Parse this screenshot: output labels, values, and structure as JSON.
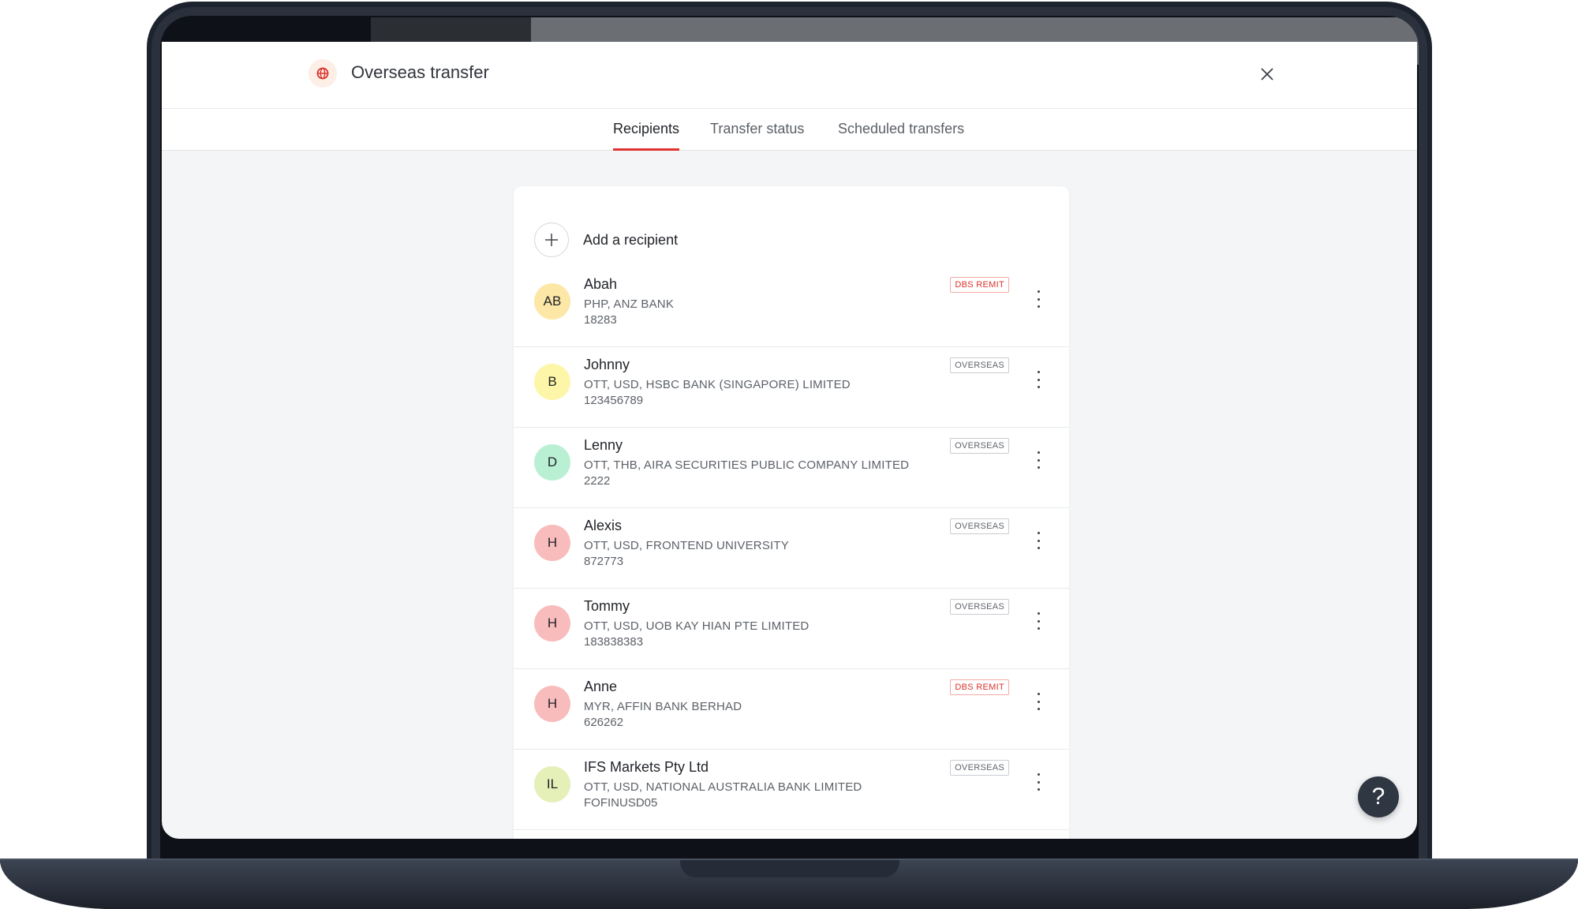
{
  "header": {
    "title": "Overseas transfer",
    "logo_icon": "globe-icon",
    "close_icon": "close-icon"
  },
  "tabs": [
    {
      "label": "Recipients",
      "active": true
    },
    {
      "label": "Transfer status",
      "active": false
    },
    {
      "label": "Scheduled transfers",
      "active": false
    }
  ],
  "add_recipient": {
    "label": "Add a recipient",
    "icon": "plus-icon"
  },
  "recipients": [
    {
      "initials": "AB",
      "name": "Abah",
      "detail": "PHP, ANZ BANK",
      "account": "18283",
      "badge": "DBS REMIT",
      "badge_type": "remit",
      "avatar_color": "#fde7a6"
    },
    {
      "initials": "B",
      "name": "Johnny",
      "detail": "OTT, USD, HSBC BANK (SINGAPORE) LIMITED",
      "account": "123456789",
      "badge": "OVERSEAS",
      "badge_type": "overseas",
      "avatar_color": "#fdf6a8"
    },
    {
      "initials": "D",
      "name": "Lenny",
      "detail": "OTT, THB, AIRA SECURITIES PUBLIC COMPANY LIMITED",
      "account": "2222",
      "badge": "OVERSEAS",
      "badge_type": "overseas",
      "avatar_color": "#b9f0d3"
    },
    {
      "initials": "H",
      "name": "Alexis",
      "detail": "OTT, USD, FRONTEND UNIVERSITY",
      "account": "872773",
      "badge": "OVERSEAS",
      "badge_type": "overseas",
      "avatar_color": "#f9bcbc"
    },
    {
      "initials": "H",
      "name": "Tommy",
      "detail": "OTT, USD, UOB KAY HIAN PTE LIMITED",
      "account": "183838383",
      "badge": "OVERSEAS",
      "badge_type": "overseas",
      "avatar_color": "#f9bcbc"
    },
    {
      "initials": "H",
      "name": "Anne",
      "detail": "MYR, AFFIN BANK BERHAD",
      "account": "626262",
      "badge": "DBS REMIT",
      "badge_type": "remit",
      "avatar_color": "#f9bcbc"
    },
    {
      "initials": "IL",
      "name": "IFS Markets Pty Ltd",
      "detail": "OTT, USD, NATIONAL AUSTRALIA BANK LIMITED",
      "account": "FOFINUSD05",
      "badge": "OVERSEAS",
      "badge_type": "overseas",
      "avatar_color": "#e4f0b8"
    }
  ],
  "help": {
    "label": "?",
    "icon": "help-icon"
  },
  "colors": {
    "accent": "#e0322e",
    "help_button": "#2f3742"
  }
}
